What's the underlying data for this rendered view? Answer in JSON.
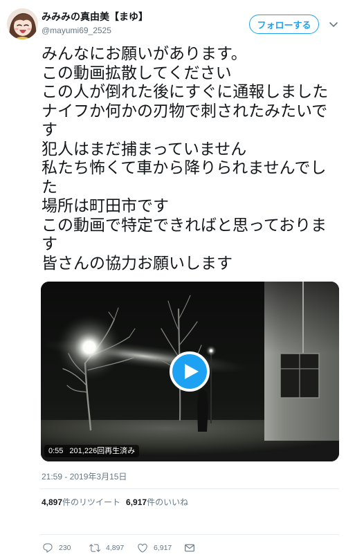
{
  "author": {
    "name": "みみみの真由美【まゆ】",
    "handle": "@mayumi69_2525"
  },
  "header": {
    "follow_label": "フォローする",
    "menu_icon": "chevron-down-icon"
  },
  "tweet": {
    "lines": [
      "みんなにお願いがあります。",
      "この動画拡散してください",
      "この人が倒れた後にすぐに通報しました",
      "ナイフか何かの刃物で刺されたみたいです",
      "犯人はまだ捕まっていません",
      "私たち怖くて車から降りられませんでした",
      "場所は町田市です",
      "この動画で特定できればと思っております",
      "皆さんの協力お願いします"
    ]
  },
  "media": {
    "play_icon": "play-icon",
    "duration": "0:55",
    "views": "201,226回再生済み"
  },
  "timestamp": "21:59 - 2019年3月15日",
  "stats": {
    "retweets": {
      "count": "4,897",
      "label": "件のリツイート"
    },
    "likes": {
      "count": "6,917",
      "label": "件のいいね"
    }
  },
  "actions": {
    "reply": {
      "icon": "reply-icon",
      "count": "230"
    },
    "retweet": {
      "icon": "retweet-icon",
      "count": "4,897"
    },
    "like": {
      "icon": "heart-icon",
      "count": "6,917"
    },
    "message": {
      "icon": "mail-icon"
    }
  },
  "colors": {
    "accent": "#1da1f2",
    "text": "#14171a",
    "secondary": "#657786",
    "border": "#e6ecf0"
  }
}
